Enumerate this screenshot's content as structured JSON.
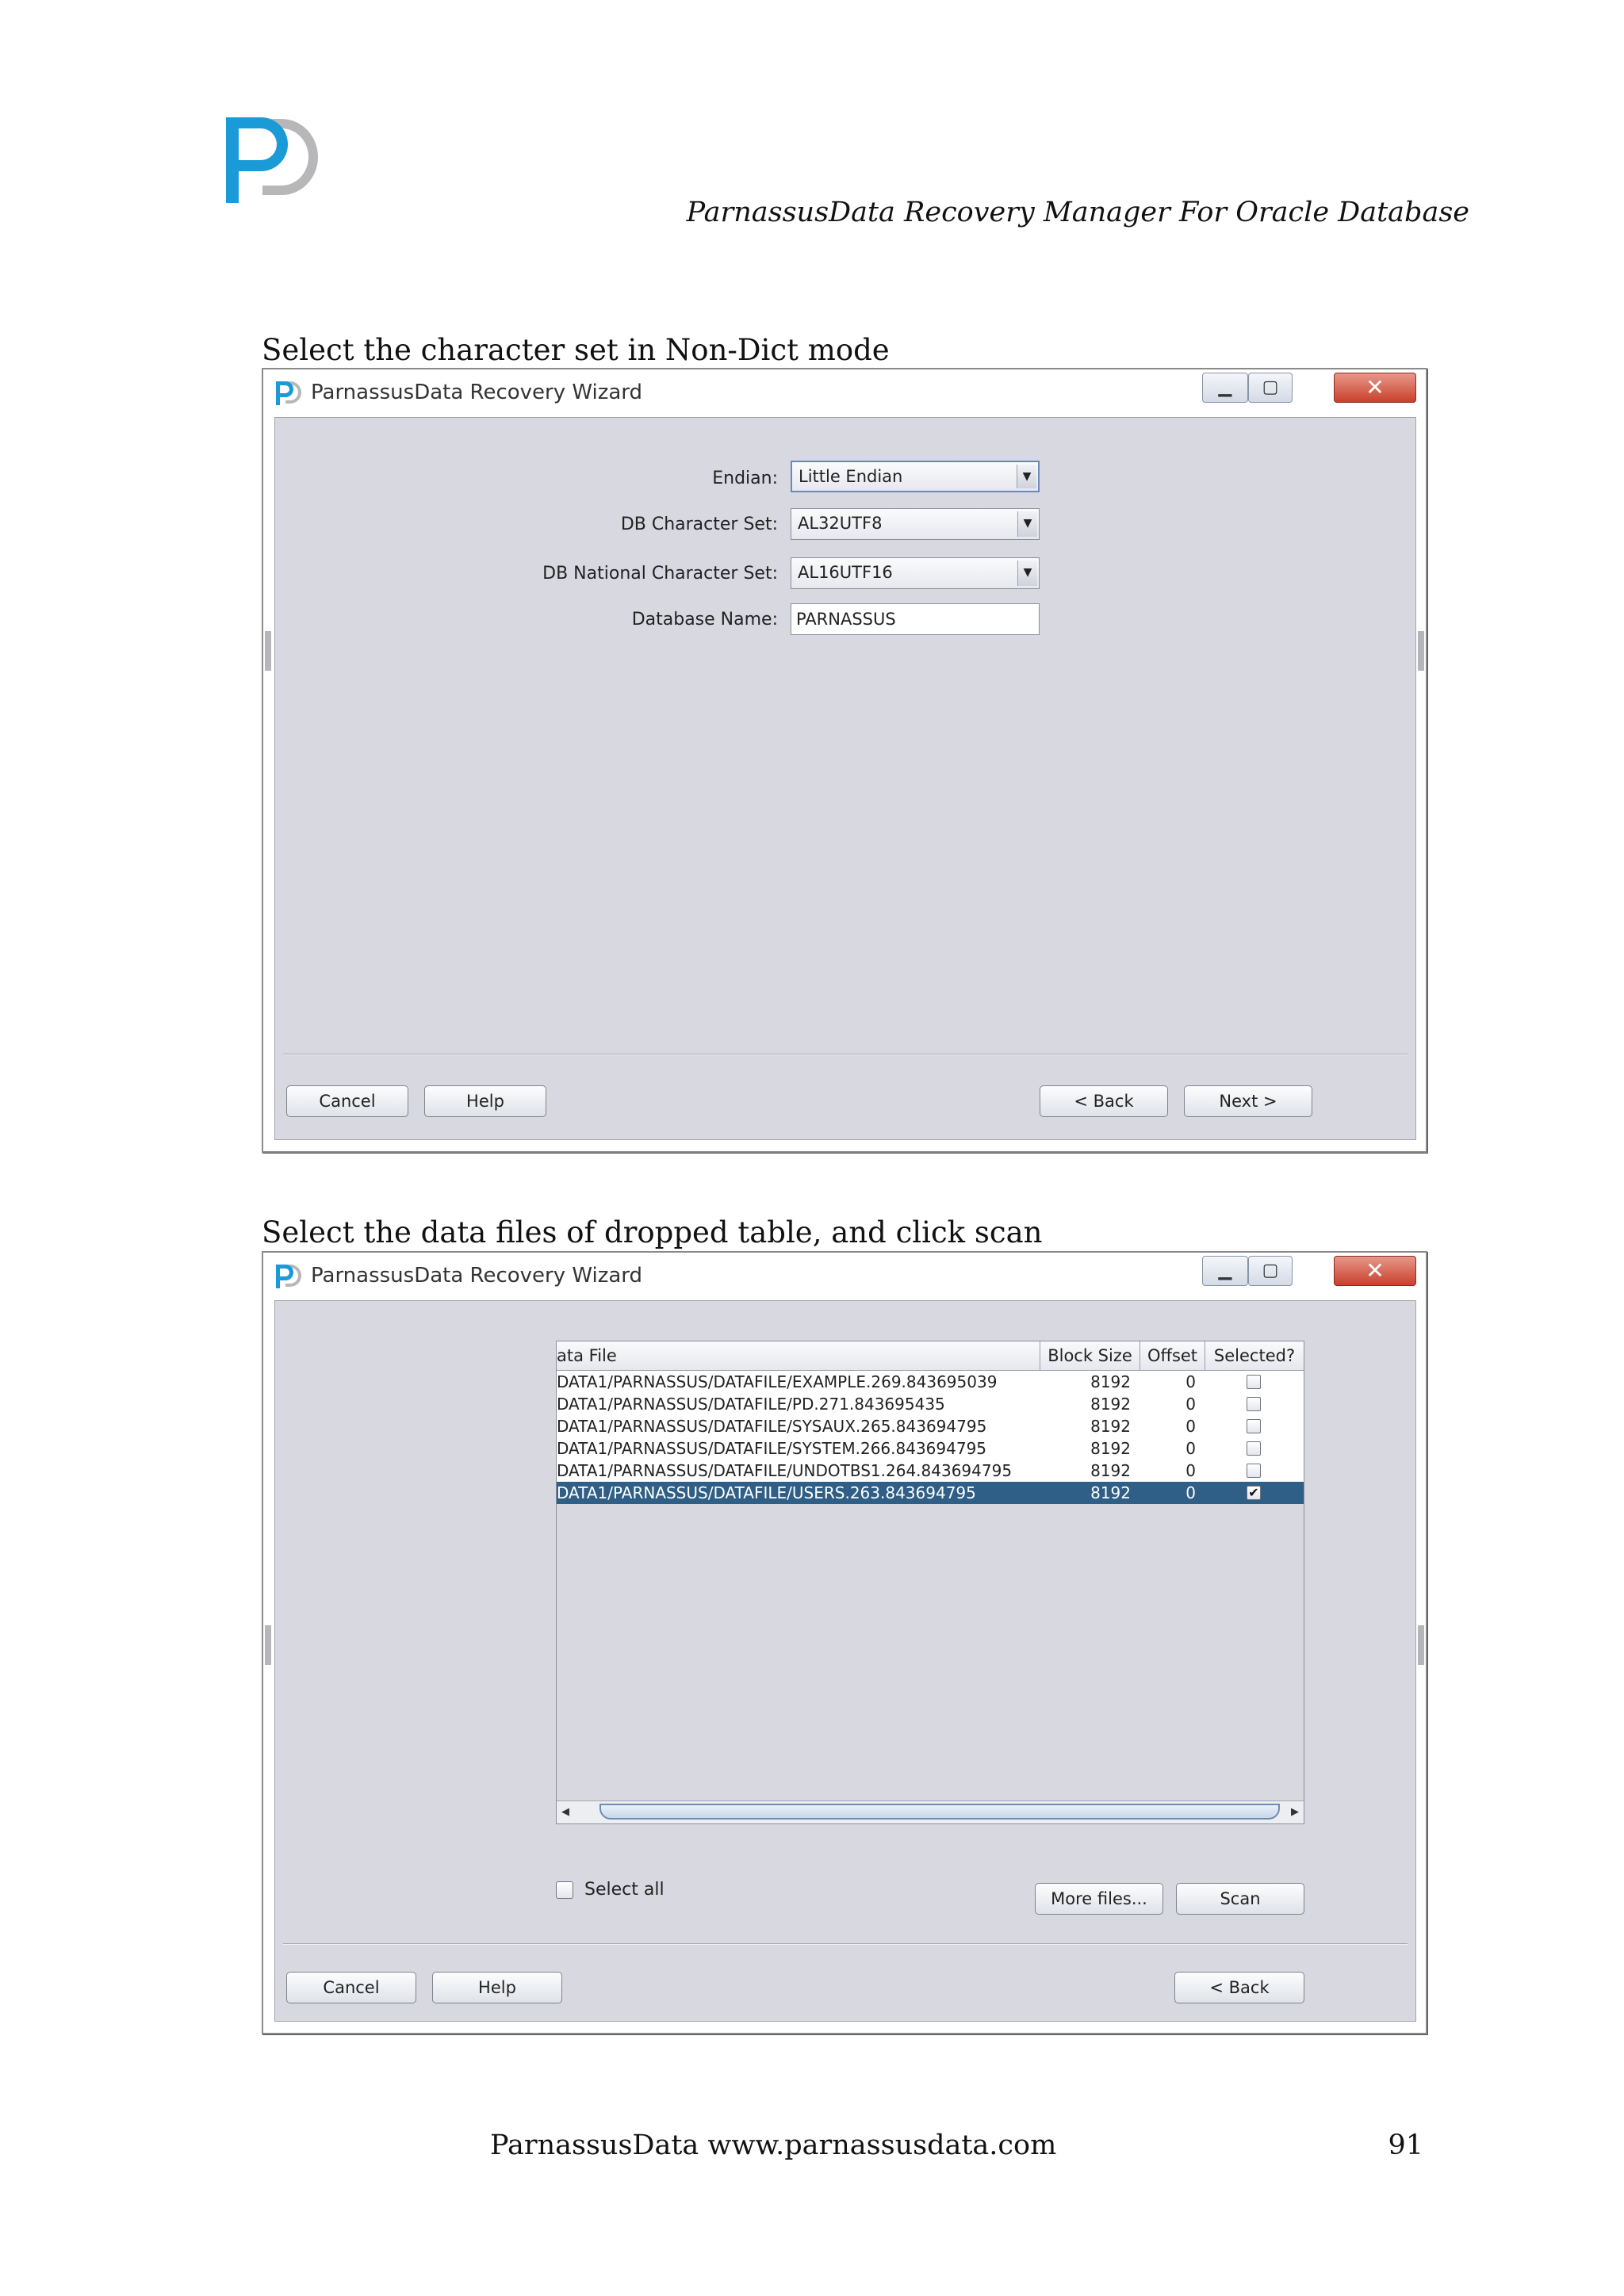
{
  "page": {
    "header_title": "ParnassusData Recovery Manager For Oracle Database",
    "footer_text": "ParnassusData www.parnassusdata.com",
    "page_number": "91",
    "logo_letters": "PD",
    "colors": {
      "logo_blue": "#1a9ad6",
      "logo_gray": "#b7b7b9",
      "selected_row": "#2f5f86",
      "panel_bg": "#d8d9e0"
    }
  },
  "figure1": {
    "caption": "Select the character set in Non-Dict mode",
    "window_title": "ParnassusData Recovery Wizard",
    "form": {
      "endian_label": "Endian:",
      "endian_value": "Little Endian",
      "db_charset_label": "DB Character Set:",
      "db_charset_value": "AL32UTF8",
      "db_ncharset_label": "DB National Character Set:",
      "db_ncharset_value": "AL16UTF16",
      "db_name_label": "Database Name:",
      "db_name_value": "PARNASSUS"
    },
    "buttons": {
      "cancel": "Cancel",
      "help": "Help",
      "back": "<  Back",
      "next": "Next  >"
    }
  },
  "figure2": {
    "caption": "Select the data files of dropped table, and click scan",
    "window_title": "ParnassusData Recovery Wizard",
    "table": {
      "headers": [
        "ata File",
        "Block Size",
        "Offset",
        "Selected?"
      ],
      "rows": [
        {
          "file": "DATA1/PARNASSUS/DATAFILE/EXAMPLE.269.843695039",
          "block_size": "8192",
          "offset": "0",
          "selected": false
        },
        {
          "file": "DATA1/PARNASSUS/DATAFILE/PD.271.843695435",
          "block_size": "8192",
          "offset": "0",
          "selected": false
        },
        {
          "file": "DATA1/PARNASSUS/DATAFILE/SYSAUX.265.843694795",
          "block_size": "8192",
          "offset": "0",
          "selected": false
        },
        {
          "file": "DATA1/PARNASSUS/DATAFILE/SYSTEM.266.843694795",
          "block_size": "8192",
          "offset": "0",
          "selected": false
        },
        {
          "file": "DATA1/PARNASSUS/DATAFILE/UNDOTBS1.264.843694795",
          "block_size": "8192",
          "offset": "0",
          "selected": false
        },
        {
          "file": "DATA1/PARNASSUS/DATAFILE/USERS.263.843694795",
          "block_size": "8192",
          "offset": "0",
          "selected": true
        }
      ]
    },
    "select_all_label": "Select all",
    "select_all_checked": false,
    "buttons": {
      "more_files": "More files...",
      "scan": "Scan",
      "cancel": "Cancel",
      "help": "Help",
      "back": "<  Back"
    }
  }
}
